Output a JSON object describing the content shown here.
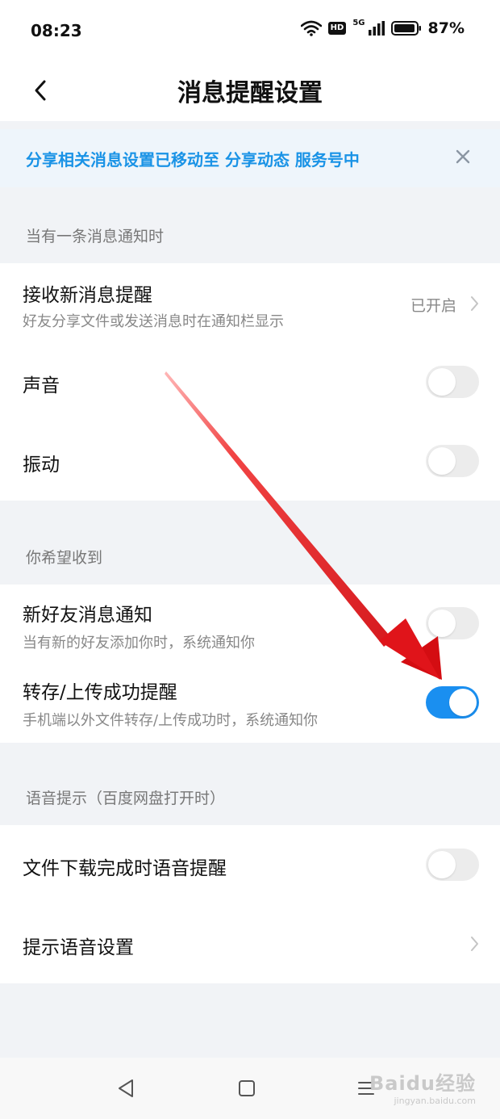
{
  "status_bar": {
    "time": "08:23",
    "hd": "HD",
    "signal_label": "5G",
    "battery": "87%"
  },
  "header": {
    "title": "消息提醒设置",
    "back_icon": "chevron-left-icon"
  },
  "notice": {
    "text": "分享相关消息设置已移动至 分享动态 服务号中",
    "close_icon": "close-icon",
    "color": "#1a93e6"
  },
  "sections": {
    "s1": {
      "label": "当有一条消息通知时",
      "receive": {
        "title": "接收新消息提醒",
        "subtitle": "好友分享文件或发送消息时在通知栏显示",
        "value": "已开启"
      },
      "sound": {
        "title": "声音",
        "enabled": false
      },
      "vibrate": {
        "title": "振动",
        "enabled": false
      }
    },
    "s2": {
      "label": "你希望收到",
      "new_friend": {
        "title": "新好友消息通知",
        "subtitle": "当有新的好友添加你时，系统通知你",
        "enabled": false
      },
      "transfer": {
        "title": "转存/上传成功提醒",
        "subtitle": "手机端以外文件转存/上传成功时，系统通知你",
        "enabled": true
      }
    },
    "s3": {
      "label": "语音提示（百度网盘打开时）",
      "download_voice": {
        "title": "文件下载完成时语音提醒",
        "enabled": false
      },
      "voice_settings": {
        "title": "提示语音设置"
      }
    }
  },
  "colors": {
    "toggle_on": "#1a8ff0",
    "toggle_off": "#ececec",
    "annotation_arrow": "#e5141a"
  },
  "watermark": {
    "main": "Baidu经验",
    "sub": "jingyan.baidu.com"
  }
}
